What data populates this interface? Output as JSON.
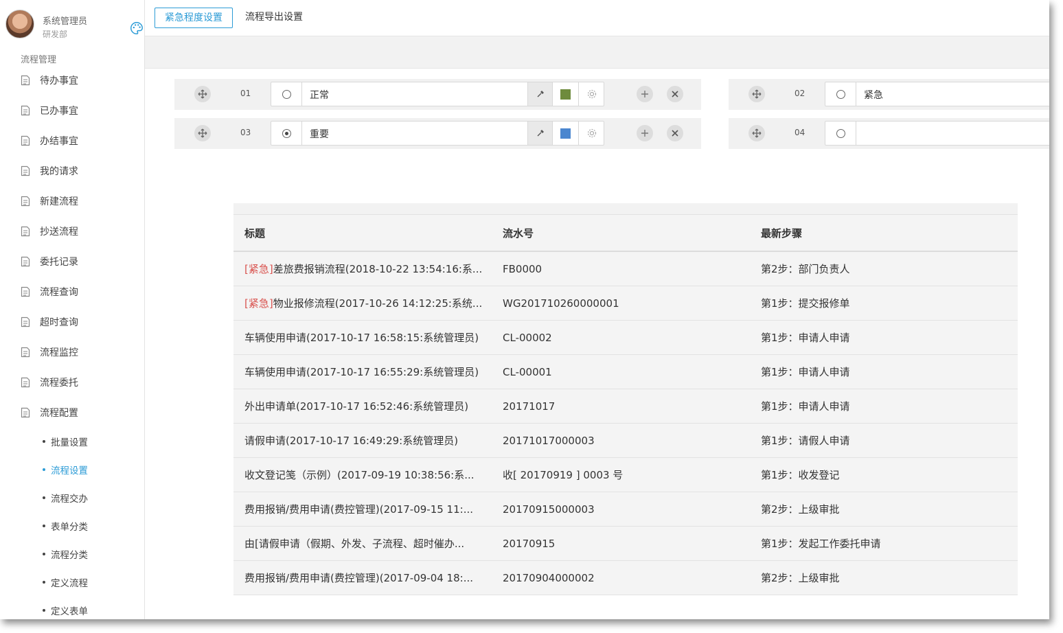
{
  "user": {
    "name": "系统管理员",
    "dept": "研发部"
  },
  "sidebar": {
    "section": "流程管理",
    "items": [
      {
        "label": "待办事宜"
      },
      {
        "label": "已办事宜"
      },
      {
        "label": "办结事宜"
      },
      {
        "label": "我的请求"
      },
      {
        "label": "新建流程"
      },
      {
        "label": "抄送流程"
      },
      {
        "label": "委托记录"
      },
      {
        "label": "流程查询"
      },
      {
        "label": "超时查询"
      },
      {
        "label": "流程监控"
      },
      {
        "label": "流程委托"
      },
      {
        "label": "流程配置"
      }
    ],
    "sub_items": [
      {
        "label": "批量设置"
      },
      {
        "label": "流程设置"
      },
      {
        "label": "流程交办"
      },
      {
        "label": "表单分类"
      },
      {
        "label": "流程分类"
      },
      {
        "label": "定义流程"
      },
      {
        "label": "定义表单"
      }
    ]
  },
  "tabs": {
    "urgency": "紧急程度设置",
    "export": "流程导出设置"
  },
  "levels": [
    {
      "num": "01",
      "name": "正常",
      "color": "#6e8b3d",
      "checked": false
    },
    {
      "num": "02",
      "name": "紧急",
      "checked": false
    },
    {
      "num": "03",
      "name": "重要",
      "color": "#4a86cf",
      "checked": true
    },
    {
      "num": "04",
      "name": "",
      "checked": false
    }
  ],
  "table": {
    "headers": [
      "标题",
      "流水号",
      "最新步骤"
    ],
    "rows": [
      {
        "tag": "[紧急]",
        "title": "差旅费报销流程(2018-10-22 13:54:16:系...",
        "serial": "FB0000",
        "step": "第2步：部门负责人"
      },
      {
        "tag": "[紧急]",
        "title": "物业报修流程(2017-10-26 14:12:25:系统...",
        "serial": "WG201710260000001",
        "step": "第1步：提交报修单"
      },
      {
        "tag": "",
        "title": "车辆使用申请(2017-10-17 16:58:15:系统管理员)",
        "serial": "CL-00002",
        "step": "第1步：申请人申请"
      },
      {
        "tag": "",
        "title": "车辆使用申请(2017-10-17 16:55:29:系统管理员)",
        "serial": "CL-00001",
        "step": "第1步：申请人申请"
      },
      {
        "tag": "",
        "title": "外出申请单(2017-10-17 16:52:46:系统管理员)",
        "serial": "20171017",
        "step": "第1步：申请人申请"
      },
      {
        "tag": "",
        "title": "请假申请(2017-10-17 16:49:29:系统管理员)",
        "serial": "20171017000003",
        "step": "第1步：请假人申请"
      },
      {
        "tag": "",
        "title": "收文登记笺（示例）(2017-09-19 10:38:56:系...",
        "serial": "收[ 20170919 ] 0003 号",
        "step": "第1步：收发登记"
      },
      {
        "tag": "",
        "title": "费用报销/费用申请(费控管理)(2017-09-15 11:...",
        "serial": "20170915000003",
        "step": "第2步：上级审批"
      },
      {
        "tag": "",
        "title": "由[请假申请（假期、外发、子流程、超时催办...",
        "serial": "20170915",
        "step": "第1步：发起工作委托申请"
      },
      {
        "tag": "",
        "title": "费用报销/费用申请(费控管理)(2017-09-04 18:...",
        "serial": "20170904000002",
        "step": "第2步：上级审批"
      }
    ]
  }
}
